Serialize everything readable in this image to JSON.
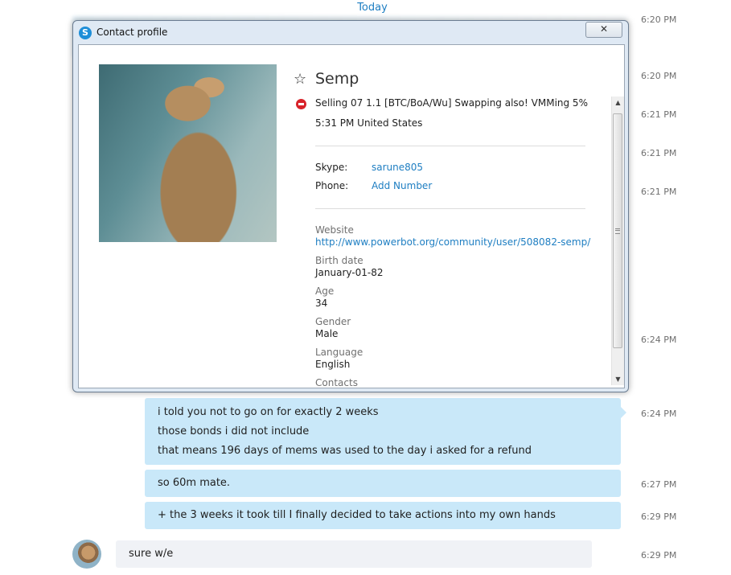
{
  "chat": {
    "today_label": "Today",
    "timestamps": [
      "6:20 PM",
      "6:20 PM",
      "6:21 PM",
      "6:21 PM",
      "6:21 PM",
      "6:24 PM",
      "6:24 PM",
      "6:27 PM",
      "6:29 PM",
      "6:29 PM"
    ],
    "messages": [
      {
        "lines": [
          "i told you not to go on for exactly 2 weeks",
          "those bonds i did not include",
          "that means 196 days of mems was used to the day i asked for a refund"
        ]
      },
      {
        "lines": [
          "so 60m mate."
        ]
      },
      {
        "lines": [
          "+ the 3 weeks it took till I finally decided to take actions into my own hands"
        ]
      },
      {
        "lines": [
          "sure w/e"
        ]
      }
    ]
  },
  "dialog": {
    "title": "Contact profile",
    "close_glyph": "✕",
    "name": "Semp",
    "mood": "Selling 07 1.1 [BTC/BoA/Wu] Swapping also! VMMing 5%",
    "local_time": "5:31 PM United States",
    "skype_label": "Skype:",
    "skype_value": "sarune805",
    "phone_label": "Phone:",
    "phone_value": "Add Number",
    "website_label": "Website",
    "website_value": "http://www.powerbot.org/community/user/508082-semp/",
    "birth_label": "Birth date",
    "birth_value": "January-01-82",
    "age_label": "Age",
    "age_value": "34",
    "gender_label": "Gender",
    "gender_value": "Male",
    "language_label": "Language",
    "language_value": "English",
    "contacts_label": "Contacts"
  },
  "icons": {
    "skype": "skype-logo-icon",
    "star": "star-outline-icon",
    "status": "do-not-disturb-icon",
    "close": "close-icon"
  },
  "colors": {
    "link": "#1e7ec2",
    "bubble_out": "#c9e8f9",
    "bubble_in": "#f0f2f6",
    "status_dnd": "#d8232a"
  }
}
